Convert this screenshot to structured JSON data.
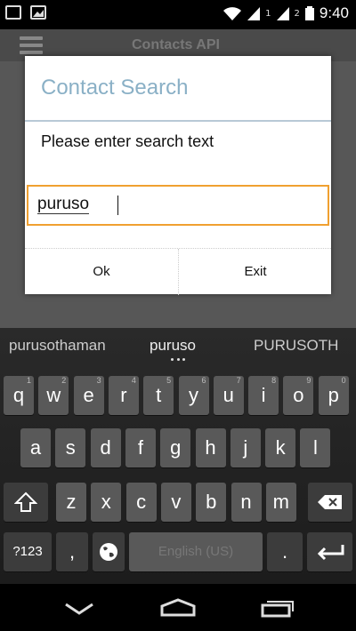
{
  "status_bar": {
    "time": "9:40",
    "sim1": "1",
    "sim2": "2"
  },
  "app": {
    "title": "Contacts API"
  },
  "dialog": {
    "title": "Contact Search",
    "message": "Please enter search text",
    "input_value": "puruso",
    "ok_label": "Ok",
    "exit_label": "Exit"
  },
  "keyboard": {
    "suggestions": [
      "purusothaman",
      "puruso",
      "PURUSOTH"
    ],
    "row1": [
      {
        "k": "q",
        "alt": "1"
      },
      {
        "k": "w",
        "alt": "2"
      },
      {
        "k": "e",
        "alt": "3"
      },
      {
        "k": "r",
        "alt": "4"
      },
      {
        "k": "t",
        "alt": "5"
      },
      {
        "k": "y",
        "alt": "6"
      },
      {
        "k": "u",
        "alt": "7"
      },
      {
        "k": "i",
        "alt": "8"
      },
      {
        "k": "o",
        "alt": "9"
      },
      {
        "k": "p",
        "alt": "0"
      }
    ],
    "row2": [
      "a",
      "s",
      "d",
      "f",
      "g",
      "h",
      "j",
      "k",
      "l"
    ],
    "row3": [
      "z",
      "x",
      "c",
      "v",
      "b",
      "n",
      "m"
    ],
    "symbols_label": "?123",
    "comma_label": ",",
    "space_label": "English (US)",
    "period_label": "."
  },
  "colors": {
    "accent_input": "#f0a030",
    "dialog_title": "#8ab0c6"
  }
}
